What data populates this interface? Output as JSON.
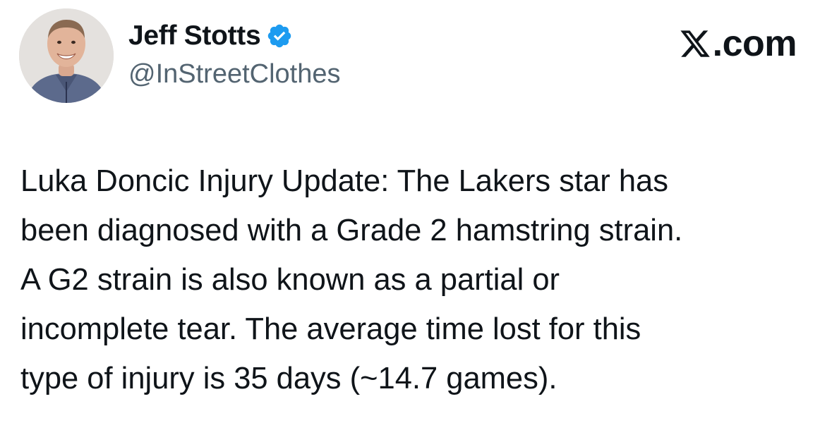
{
  "author": {
    "display_name": "Jeff Stotts",
    "handle": "@InStreetClothes",
    "verified": true,
    "badge_color": "#1d9bf0"
  },
  "brand": {
    "logo_mark": "X",
    "suffix": ".com"
  },
  "tweet": {
    "lines": [
      "Luka Doncic Injury Update: The Lakers star has",
      "been diagnosed with a Grade 2 hamstring strain.",
      "A G2 strain is also known as a partial or",
      "incomplete tear. The average time lost for this",
      "type of injury is 35 days (~14.7 games)."
    ]
  },
  "icons": {
    "avatar": "profile-photo",
    "verified": "verified-badge-icon",
    "brand": "x-logo-icon"
  },
  "colors": {
    "text": "#0f1419",
    "secondary_text": "#536471",
    "background": "#ffffff"
  }
}
